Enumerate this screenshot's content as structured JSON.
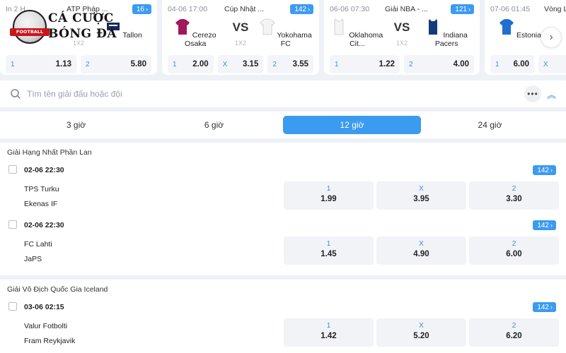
{
  "featured": [
    {
      "time": "In 2 H",
      "league": "ATP Pháp ...",
      "count": "16",
      "home": "",
      "away": "Tallon",
      "bet_type": "1X2",
      "odds": [
        {
          "label": "1",
          "value": "1.13"
        },
        {
          "label": "2",
          "value": "5.80"
        }
      ]
    },
    {
      "time": "04-06 17:00",
      "league": "Cúp Nhật ...",
      "count": "142",
      "home": "Cerezo Osaka",
      "away": "Yokohama FC",
      "vs": "VS",
      "bet_type": "1X2",
      "odds": [
        {
          "label": "1",
          "value": "2.00"
        },
        {
          "label": "X",
          "value": "3.15"
        },
        {
          "label": "2",
          "value": "3.55"
        }
      ]
    },
    {
      "time": "06-06 07:30",
      "league": "Giải NBA - ...",
      "count": "121",
      "home": "Oklahoma Cit...",
      "away": "Indiana Pacers",
      "vs": "VS",
      "bet_type": "1X2",
      "odds": [
        {
          "label": "1",
          "value": "1.22"
        },
        {
          "label": "2",
          "value": "4.00"
        }
      ]
    },
    {
      "time": "07-06 01:45",
      "league": "Vòng L",
      "home": "Estonia",
      "odds": [
        {
          "label": "1",
          "value": "6.00"
        },
        {
          "label": "X",
          "value": ""
        }
      ]
    }
  ],
  "logo": {
    "line1": "CÁ CƯỢC",
    "line2": "BÓNG ĐÁ",
    "ribbon": "FOOTBALL"
  },
  "search": {
    "placeholder": "Tìm tên giải đấu hoặc đội",
    "more_icon": "more-dots-icon",
    "collapse_icon": "chevrons-up-icon"
  },
  "time_tabs": [
    "3 giờ",
    "6 giờ",
    "12 giờ",
    "24 giờ"
  ],
  "active_tab": "12 giờ",
  "leagues": [
    {
      "name": "Giải Hạng Nhất Phần Lan",
      "matches": [
        {
          "datetime": "02-06 22:30",
          "count": "142",
          "home": "TPS Turku",
          "away": "Ekenas IF",
          "odds": [
            {
              "label": "1",
              "value": "1.99"
            },
            {
              "label": "X",
              "value": "3.95"
            },
            {
              "label": "2",
              "value": "3.30"
            }
          ]
        },
        {
          "datetime": "02-06 22:30",
          "count": "142",
          "home": "FC Lahti",
          "away": "JaPS",
          "odds": [
            {
              "label": "1",
              "value": "1.45"
            },
            {
              "label": "X",
              "value": "4.90"
            },
            {
              "label": "2",
              "value": "6.00"
            }
          ]
        }
      ]
    },
    {
      "name": "Giải Vô Địch Quốc Gia Iceland",
      "matches": [
        {
          "datetime": "03-06 02:15",
          "count": "142",
          "home": "Valur Fotbolti",
          "away": "Fram Reykjavik",
          "odds": [
            {
              "label": "1",
              "value": "1.42"
            },
            {
              "label": "X",
              "value": "5.20"
            },
            {
              "label": "2",
              "value": "6.20"
            }
          ]
        }
      ]
    }
  ],
  "colors": {
    "accent": "#3b9bf0",
    "odds_label": "#3b8de0",
    "page_bg": "#eef1f6"
  }
}
